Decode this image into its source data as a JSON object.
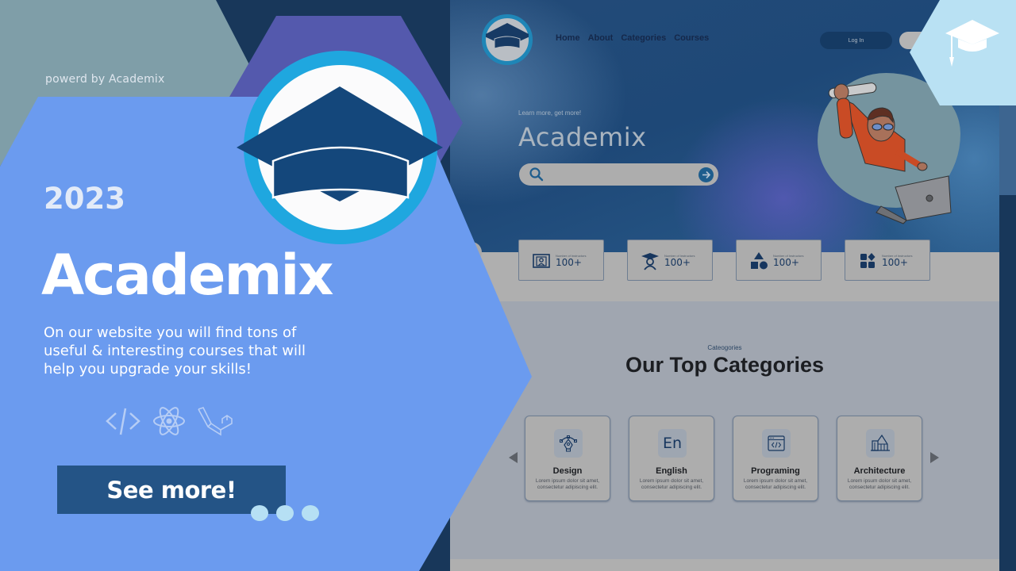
{
  "promo": {
    "powered_by": "powerd by Academix",
    "year": "2023",
    "brand": "Academix",
    "description": "On our website you will find tons of useful & interesting courses that will help you upgrade your skills!",
    "tech_icons": [
      "code-icon",
      "react-icon",
      "laravel-icon"
    ],
    "cta_label": "See more!",
    "slide_dots": 3,
    "colors": {
      "primary_blue": "#6b9bef",
      "navy": "#18375a",
      "purple": "#5459ad",
      "slate": "#7f9ea8",
      "button": "#245486",
      "dots": "#b6e0f4",
      "badge": "#b9e1f3"
    }
  },
  "website": {
    "nav": [
      "Home",
      "About",
      "Categories",
      "Courses"
    ],
    "login_label": "Log In",
    "tagline": "Learn more, get more!",
    "hero_title": "Academix",
    "search": {
      "placeholder": "",
      "value": ""
    },
    "stats": [
      {
        "icon": "instructor-board-icon",
        "label": "Number of Instructors",
        "value": "100+"
      },
      {
        "icon": "graduate-icon",
        "label": "Number of Instructors",
        "value": "100+"
      },
      {
        "icon": "shapes-icon",
        "label": "Number of Instructors",
        "value": "100+"
      },
      {
        "icon": "apps-grid-icon",
        "label": "Number of Instructors",
        "value": "100+"
      }
    ],
    "categories_kicker": "Cateogories",
    "categories_title": "Our Top Categories",
    "categories": [
      {
        "icon": "pen-tool-icon",
        "name": "Design",
        "desc": "Lorem ipsum dolor sit amet, consectetur adipiscing elit."
      },
      {
        "icon": "english-icon",
        "icon_text": "En",
        "name": "English",
        "desc": "Lorem ipsum dolor sit amet, consectetur adipiscing elit."
      },
      {
        "icon": "code-window-icon",
        "name": "Programing",
        "desc": "Lorem ipsum dolor sit amet, consectetur adipiscing elit."
      },
      {
        "icon": "building-icon",
        "name": "Architecture",
        "desc": "Lorem ipsum dolor sit amet, consectetur adipiscing elit."
      }
    ]
  }
}
